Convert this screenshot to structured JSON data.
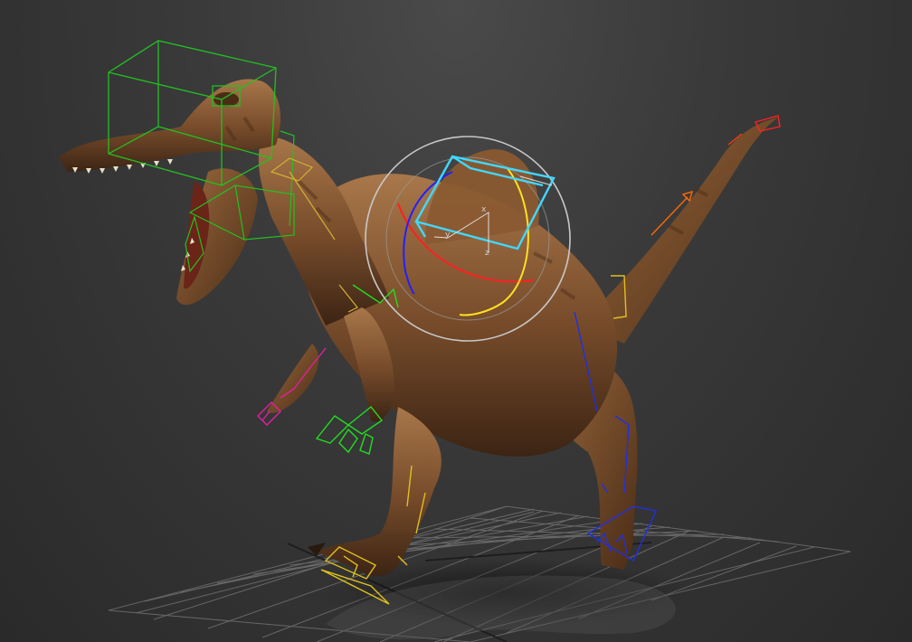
{
  "viewport": {
    "background_top": "#4a4a4a",
    "background_bottom": "#2a2a2a",
    "grid_color": "#9a9a9a"
  },
  "model": {
    "name": "spinosaurus",
    "skin_color": "#7a4e2c",
    "skin_highlight": "#a8774a",
    "skin_shadow": "#3c2414"
  },
  "rig": {
    "head_controls_color": "#22c022",
    "left_arm_color": "#22dd22",
    "right_arm_color": "#e020a0",
    "left_leg_color": "#e0c020",
    "right_leg_color": "#2030e0",
    "tail_color_base": "#ff6a00",
    "tail_color_tip": "#ff2020",
    "spine_control_color": "#40d8ff",
    "rotate_gizmo": {
      "outer_ring_color": "#c8c8c8",
      "x_axis_color": "#ff2020",
      "y_axis_color": "#ffe020",
      "z_axis_color": "#2020ff",
      "axis_labels": {
        "x": "x",
        "y": "y",
        "z": "z"
      }
    }
  }
}
